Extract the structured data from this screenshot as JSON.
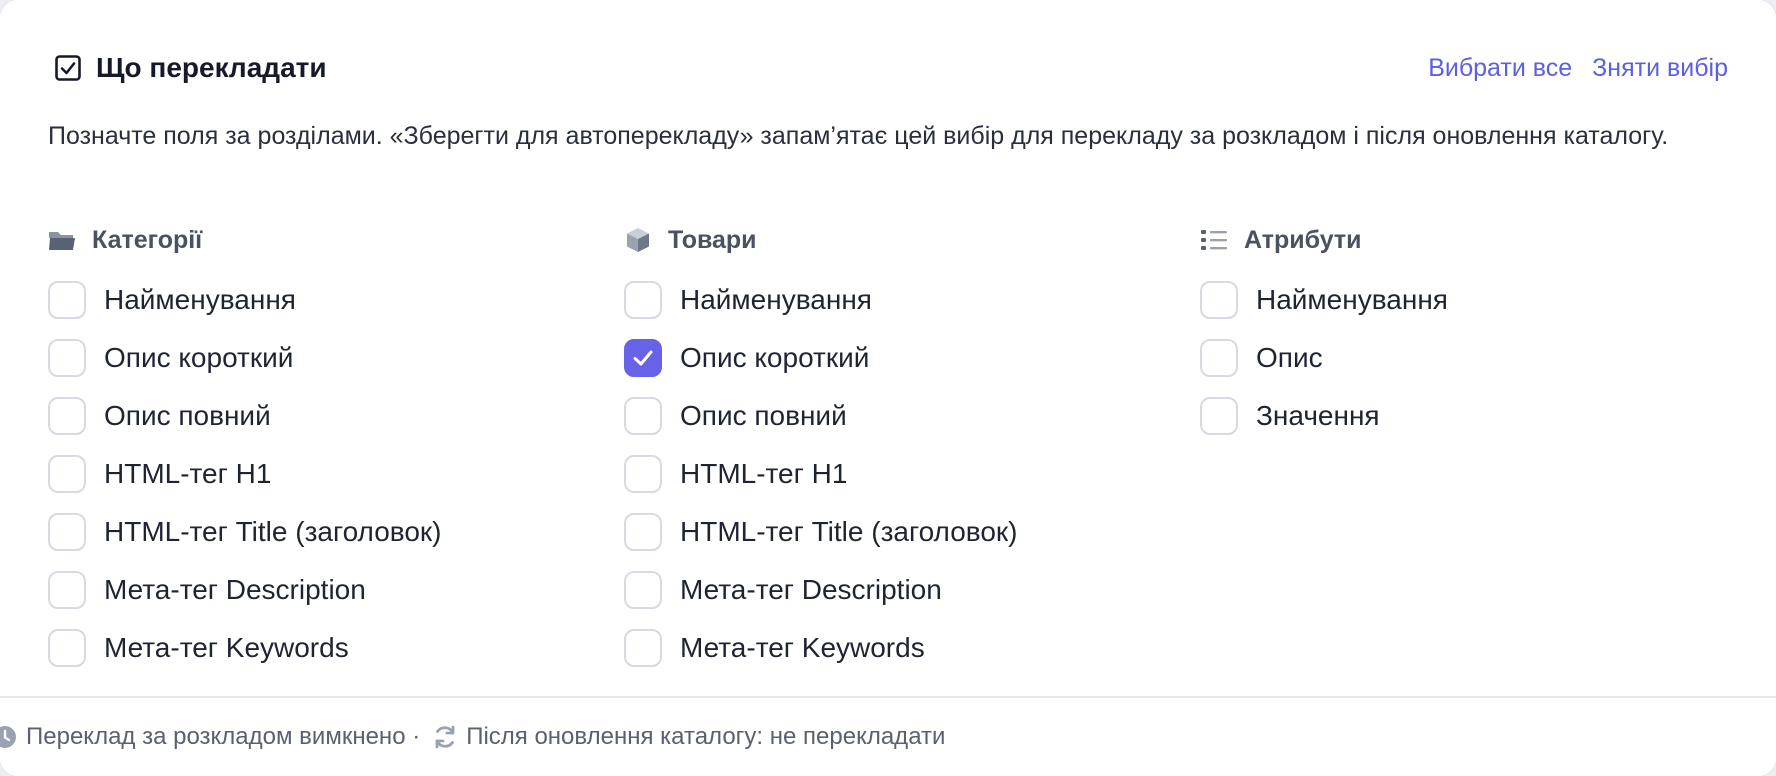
{
  "header": {
    "title": "Що перекладати",
    "select_all": "Вибрати все",
    "deselect": "Зняти вибір"
  },
  "description": "Позначте поля за розділами. «Зберегти для автоперекладу» запам’ятає цей вибір для перекладу за розкладом і після оновлення каталогу.",
  "sections": [
    {
      "title": "Категорії",
      "icon": "folder-icon",
      "items": [
        {
          "label": "Найменування",
          "checked": false
        },
        {
          "label": "Опис короткий",
          "checked": false
        },
        {
          "label": "Опис повний",
          "checked": false
        },
        {
          "label": "HTML-тег H1",
          "checked": false
        },
        {
          "label": "HTML-тег Title (заголовок)",
          "checked": false
        },
        {
          "label": "Мета-тег Description",
          "checked": false
        },
        {
          "label": "Мета-тег Keywords",
          "checked": false
        }
      ]
    },
    {
      "title": "Товари",
      "icon": "box-icon",
      "items": [
        {
          "label": "Найменування",
          "checked": false
        },
        {
          "label": "Опис короткий",
          "checked": true
        },
        {
          "label": "Опис повний",
          "checked": false
        },
        {
          "label": "HTML-тег H1",
          "checked": false
        },
        {
          "label": "HTML-тег Title (заголовок)",
          "checked": false
        },
        {
          "label": "Мета-тег Description",
          "checked": false
        },
        {
          "label": "Мета-тег Keywords",
          "checked": false
        }
      ]
    },
    {
      "title": "Атрибути",
      "icon": "list-icon",
      "items": [
        {
          "label": "Найменування",
          "checked": false
        },
        {
          "label": "Опис",
          "checked": false
        },
        {
          "label": "Значення",
          "checked": false
        }
      ]
    }
  ],
  "footer": {
    "schedule_text": "Переклад за розкладом вимкнено ·",
    "update_text": "Після оновлення каталогу: не перекладати"
  },
  "colors": {
    "accent": "#6663e8",
    "link": "#5b5fe0"
  }
}
